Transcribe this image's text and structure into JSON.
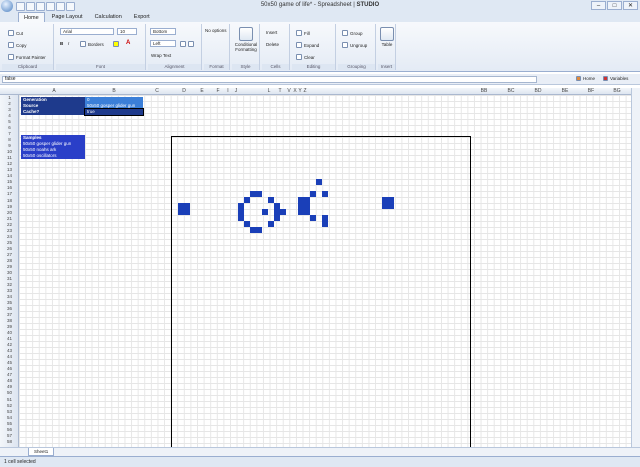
{
  "window": {
    "title": "50x50 game of life* - Spreadsheet | ",
    "brand": "STUDIO",
    "buttons": [
      "–",
      "□",
      "✕"
    ]
  },
  "tabs": [
    "Home",
    "Page Layout",
    "Calculation",
    "Export"
  ],
  "ribbon": {
    "clipboard": {
      "cut": "Cut",
      "copy": "Copy",
      "format_painter": "Format Painter",
      "label": "Clipboard"
    },
    "font": {
      "family": "Arial",
      "size": "10",
      "borders": "Borders",
      "label": "Font"
    },
    "alignment": {
      "valign": "Bottom",
      "halign": "Left",
      "wrap": "Wrap Text",
      "label": "Alignment"
    },
    "format": {
      "options": "No options",
      "label": "Format"
    },
    "style": {
      "conditional": "Conditional Formatting",
      "label": "Style"
    },
    "cells": {
      "insert": "Insert",
      "delete": "Delete",
      "label": "Cells"
    },
    "editing": {
      "fill": "Fill",
      "expand": "Expand",
      "clear": "Clear",
      "label": "Editing"
    },
    "grouping": {
      "group": "Group",
      "ungroup": "Ungroup",
      "label": "Grouping"
    },
    "insert": {
      "table": "Table",
      "label": "Insert"
    }
  },
  "formula_bar": {
    "value": "false",
    "home": "Home",
    "variables": "Variables"
  },
  "columns": [
    "A",
    "B",
    "C",
    "D",
    "E",
    "F",
    "I",
    "J",
    "L",
    "T",
    "V",
    "X",
    "Y",
    "Z",
    "BB",
    "BC",
    "BD",
    "BE",
    "BF",
    "BG"
  ],
  "rows": [
    "1",
    "2",
    "3",
    "4",
    "5",
    "6",
    "7",
    "8",
    "9",
    "10",
    "11",
    "12",
    "13",
    "14",
    "15",
    "16",
    "17",
    "18",
    "19",
    "20",
    "21",
    "22",
    "23",
    "24",
    "25",
    "26",
    "27",
    "28",
    "29",
    "30",
    "31",
    "32",
    "33",
    "34",
    "35",
    "36",
    "37",
    "38",
    "39",
    "40",
    "41",
    "42",
    "43",
    "44",
    "45",
    "46",
    "47",
    "48",
    "49",
    "50",
    "51",
    "52",
    "53",
    "54",
    "55",
    "56",
    "57",
    "58"
  ],
  "info": {
    "generation_label": "Generation",
    "generation_value": "0",
    "source_label": "Source",
    "source_value": "50x50 gosper glider gun",
    "cache_label": "Cache?",
    "cache_value": "true"
  },
  "samples": {
    "header": "Samples",
    "items": [
      "50x50 gosper glider gun",
      "50x50 noahs ark",
      "50x50 oscillators"
    ]
  },
  "board": {
    "live_cells": [
      [
        9,
        13
      ],
      [
        9,
        14
      ],
      [
        10,
        12
      ],
      [
        10,
        16
      ],
      [
        11,
        11
      ],
      [
        11,
        17
      ],
      [
        12,
        11
      ],
      [
        12,
        15
      ],
      [
        12,
        17
      ],
      [
        12,
        18
      ],
      [
        13,
        11
      ],
      [
        13,
        17
      ],
      [
        14,
        12
      ],
      [
        14,
        16
      ],
      [
        15,
        13
      ],
      [
        15,
        14
      ],
      [
        11,
        1
      ],
      [
        11,
        2
      ],
      [
        12,
        1
      ],
      [
        12,
        2
      ],
      [
        10,
        21
      ],
      [
        10,
        22
      ],
      [
        11,
        21
      ],
      [
        11,
        22
      ],
      [
        12,
        21
      ],
      [
        12,
        22
      ],
      [
        9,
        23
      ],
      [
        13,
        23
      ],
      [
        7,
        24
      ],
      [
        9,
        25
      ],
      [
        13,
        25
      ],
      [
        14,
        25
      ],
      [
        10,
        35
      ],
      [
        10,
        36
      ],
      [
        11,
        35
      ],
      [
        11,
        36
      ]
    ]
  },
  "sheet_tab": "Sheet1",
  "status": "1 cell selected"
}
